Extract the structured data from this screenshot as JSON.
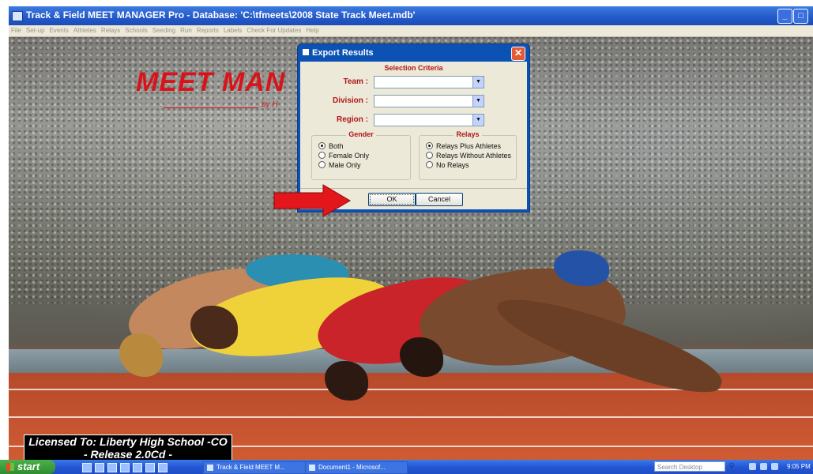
{
  "window": {
    "title": "Track & Field MEET MANAGER Pro - Database: 'C:\\tfmeets\\2008 State Track Meet.mdb'",
    "minimize_label": "_",
    "maximize_label": "□"
  },
  "menu": [
    "File",
    "Set-up",
    "Events",
    "Athletes",
    "Relays",
    "Schools",
    "Seeding",
    "Run",
    "Reports",
    "Labels",
    "Check For Updates",
    "Help"
  ],
  "background": {
    "logo_text": "MEET MAN",
    "logo_sub": "by H"
  },
  "license": {
    "line1": "Licensed To: Liberty High School -CO",
    "line2": "- Release 2.0Cd -"
  },
  "dialog": {
    "title": "Export Results",
    "close_label": "✕",
    "selection_title": "Selection Criteria",
    "team_label": "Team :",
    "division_label": "Division :",
    "region_label": "Region :",
    "team_value": "",
    "division_value": "",
    "region_value": "",
    "gender_title": "Gender",
    "gender_options": [
      "Both",
      "Female Only",
      "Male Only"
    ],
    "gender_selected": "Both",
    "relays_title": "Relays",
    "relays_options": [
      "Relays Plus Athletes",
      "Relays Without Athletes",
      "No Relays"
    ],
    "relays_selected": "Relays Plus Athletes",
    "ok_label": "OK",
    "cancel_label": "Cancel"
  },
  "taskbar": {
    "start_label": "start",
    "tasks": [
      "Track & Field MEET M...",
      "Document1 - Microsof..."
    ],
    "search_placeholder": "Search Desktop",
    "clock": "9:05 PM"
  },
  "colors": {
    "accent_red": "#b0161a",
    "xp_blue": "#0b52b4",
    "dialog_bg": "#ece9d8"
  }
}
